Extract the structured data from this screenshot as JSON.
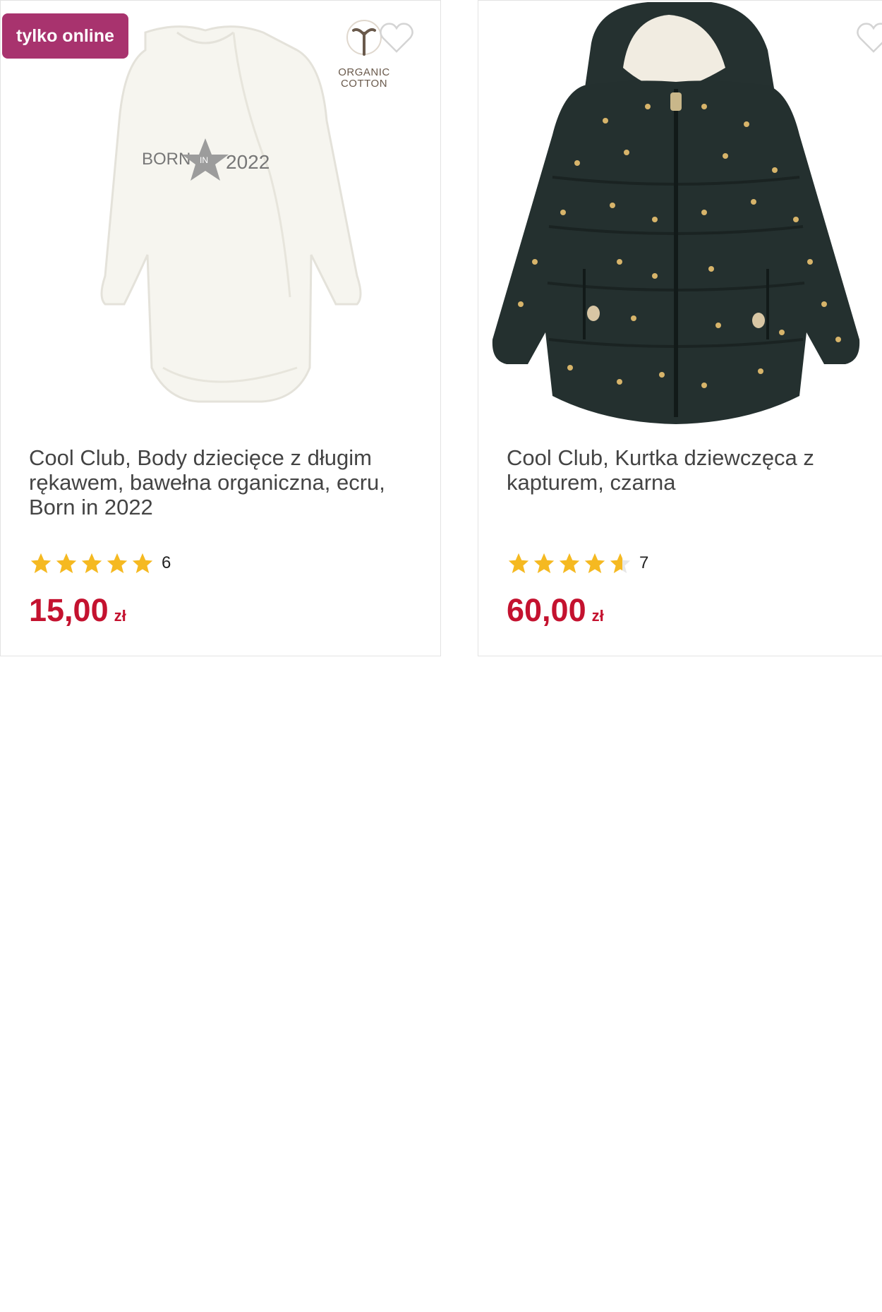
{
  "products": [
    {
      "badge": "tylko online",
      "certification_line1": "ORGANIC",
      "certification_line2": "COTTON",
      "print_text_left": "BORN",
      "print_text_mid": "IN",
      "print_text_right": "2022",
      "title": "Cool Club, Body dziecięce z długim rękawem, bawełna organiczna, ecru, Born in 2022",
      "rating": 5,
      "rating_count": "6",
      "price": "15,00",
      "currency": "zł"
    },
    {
      "title": "Cool Club, Kurtka dziewczęca z kapturem, czarna",
      "rating": 4.5,
      "rating_count": "7",
      "price": "60,00",
      "currency": "zł"
    }
  ],
  "colors": {
    "badge": "#a8336e",
    "price": "#c4122f",
    "star": "#f5b921",
    "title": "#444444"
  },
  "icons": [
    "heart-outline-icon",
    "star-icon",
    "organic-cotton-logo"
  ]
}
